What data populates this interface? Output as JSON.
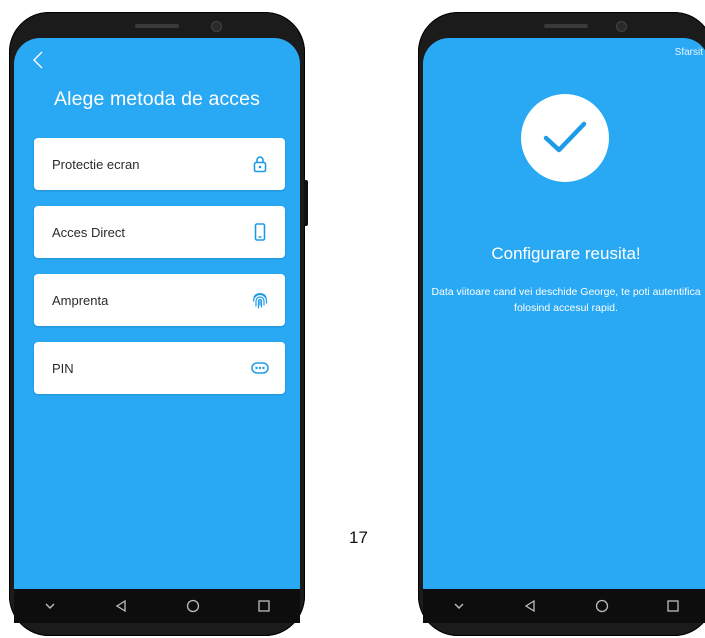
{
  "left_screen": {
    "title": "Alege metoda de acces",
    "options": [
      {
        "label": "Protectie ecran",
        "icon": "lock-icon"
      },
      {
        "label": "Acces Direct",
        "icon": "phone-icon"
      },
      {
        "label": "Amprenta",
        "icon": "fingerprint-icon"
      },
      {
        "label": "PIN",
        "icon": "pin-dots-icon"
      }
    ]
  },
  "right_screen": {
    "end_link": "Sfarsit",
    "success_title": "Configurare reusita!",
    "success_message": "Data viitoare cand vei deschide George, te poti autentifica folosind accesul rapid."
  },
  "page_number": "17",
  "colors": {
    "screen_bg": "#29a8f3",
    "accent": "#1e9be8",
    "phone_body": "#1b1b1b",
    "card": "#ffffff"
  }
}
